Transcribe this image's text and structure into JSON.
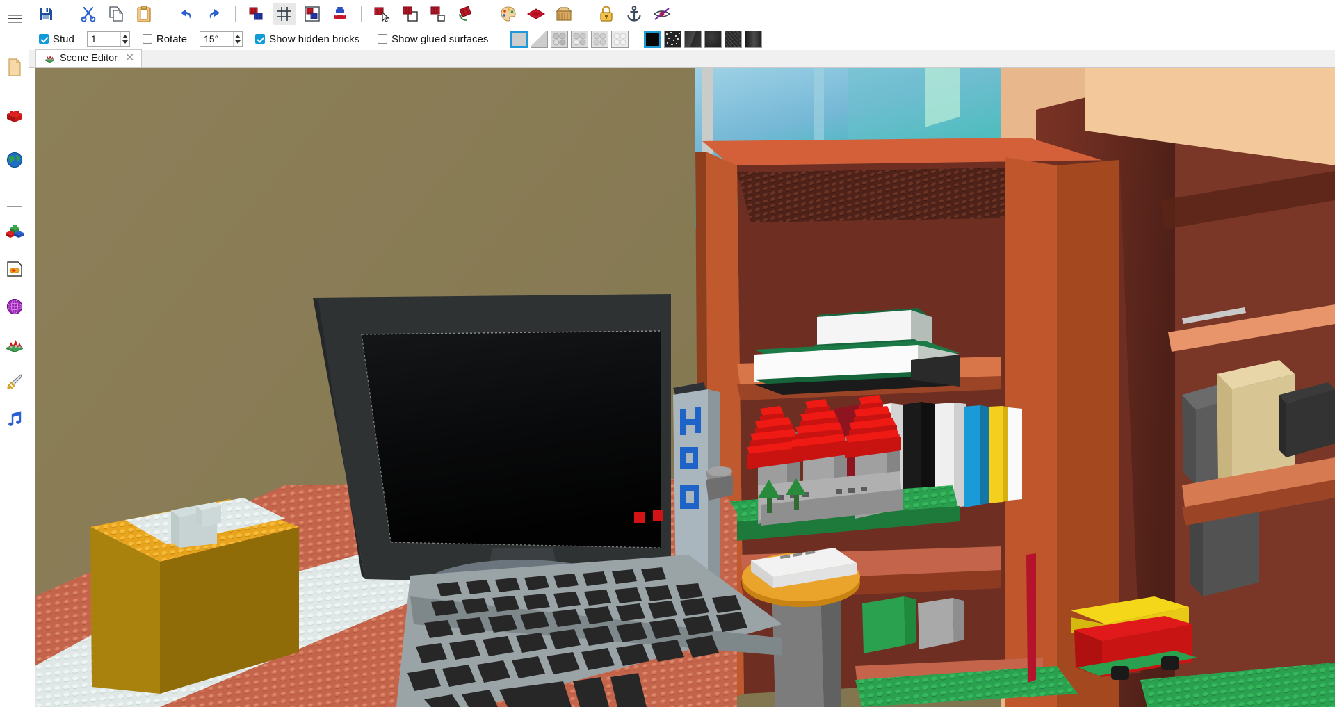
{
  "app": {
    "title": "Scene Editor"
  },
  "sidebar": {
    "items": [
      {
        "name": "menu",
        "icon": "hamburger-menu-icon",
        "label": "Menu"
      },
      {
        "name": "document",
        "icon": "document-page-icon",
        "label": "Document"
      },
      {
        "name": "brick",
        "icon": "red-brick-icon",
        "label": "Brick"
      },
      {
        "name": "world",
        "icon": "globe-icon",
        "label": "World"
      },
      {
        "name": "parts",
        "icon": "brick-group-icon",
        "label": "Parts"
      },
      {
        "name": "textures",
        "icon": "texture-page-icon",
        "label": "Textures"
      },
      {
        "name": "sphere",
        "icon": "purple-sphere-icon",
        "label": "Sphere"
      },
      {
        "name": "castle",
        "icon": "castle-icon",
        "label": "Castle"
      },
      {
        "name": "sword",
        "icon": "sword-icon",
        "label": "Sword"
      },
      {
        "name": "music",
        "icon": "music-note-icon",
        "label": "Music"
      }
    ]
  },
  "toolbar": {
    "groups": [
      {
        "buttons": [
          {
            "name": "save",
            "icon": "floppy-save-icon",
            "label": "Save",
            "active": false
          }
        ]
      },
      {
        "buttons": [
          {
            "name": "cut",
            "icon": "scissors-icon",
            "label": "Cut",
            "active": false
          },
          {
            "name": "copy",
            "icon": "copy-icon",
            "label": "Copy",
            "active": false
          },
          {
            "name": "paste",
            "icon": "clipboard-icon",
            "label": "Paste",
            "active": false
          }
        ]
      },
      {
        "buttons": [
          {
            "name": "undo",
            "icon": "undo-arrow-icon",
            "label": "Undo",
            "active": false
          },
          {
            "name": "redo",
            "icon": "redo-arrow-icon",
            "label": "Redo",
            "active": false
          }
        ]
      },
      {
        "buttons": [
          {
            "name": "insert-brick",
            "icon": "bricks-stack-icon",
            "label": "Insert Brick",
            "active": false
          },
          {
            "name": "toggle-grid",
            "icon": "grid-icon",
            "label": "Grid",
            "active": true
          },
          {
            "name": "group-bricks",
            "icon": "brick-frame-icon",
            "label": "Group",
            "active": false
          },
          {
            "name": "minifig",
            "icon": "minifig-icon",
            "label": "Minifigure",
            "active": false
          }
        ]
      },
      {
        "buttons": [
          {
            "name": "select-tool",
            "icon": "brick-cursor-icon",
            "label": "Select",
            "active": false
          },
          {
            "name": "move-tool",
            "icon": "brick-move-icon",
            "label": "Move",
            "active": false
          },
          {
            "name": "clone-tool",
            "icon": "brick-clone-icon",
            "label": "Clone",
            "active": false
          },
          {
            "name": "rotate-tool",
            "icon": "brick-rotate-icon",
            "label": "Rotate",
            "active": false
          }
        ]
      },
      {
        "buttons": [
          {
            "name": "palette",
            "icon": "paint-palette-icon",
            "label": "Color Palette",
            "active": false
          },
          {
            "name": "material",
            "icon": "red-gem-icon",
            "label": "Material",
            "active": false
          },
          {
            "name": "box",
            "icon": "cardboard-box-icon",
            "label": "Parts Bin",
            "active": false
          }
        ]
      },
      {
        "buttons": [
          {
            "name": "lock",
            "icon": "padlock-icon",
            "label": "Lock",
            "active": false
          },
          {
            "name": "anchor",
            "icon": "anchor-icon",
            "label": "Anchor",
            "active": false
          },
          {
            "name": "hide",
            "icon": "eye-crossed-icon",
            "label": "Hide",
            "active": false
          }
        ]
      }
    ]
  },
  "options": {
    "stud": {
      "label": "Stud",
      "checked": true,
      "value": "1"
    },
    "rotate": {
      "label": "Rotate",
      "checked": false,
      "value": "15°"
    },
    "show_hidden_bricks": {
      "label": "Show hidden bricks",
      "checked": true
    },
    "show_glued_surfaces": {
      "label": "Show glued surfaces",
      "checked": false
    },
    "surface_swatches": [
      {
        "name": "plain-light",
        "fill": "#cdcdcd",
        "selected": true,
        "studs": 0,
        "bevel": false
      },
      {
        "name": "plain-bevel",
        "fill": "#d2d2d2",
        "selected": false,
        "studs": 0,
        "bevel": true
      },
      {
        "name": "studs-2x2-dark",
        "fill": "#d6d6d6",
        "selected": false,
        "studs": 4,
        "studfill": "#b4b4b4"
      },
      {
        "name": "studs-2x2-mixed",
        "fill": "#dcdcdc",
        "selected": false,
        "studs": 4,
        "studfill": "#c4c4c4"
      },
      {
        "name": "studs-2x2-light",
        "fill": "#e0e0e0",
        "selected": false,
        "studs": 4,
        "studfill": "#c9c9c9"
      },
      {
        "name": "studs-2x2-faint",
        "fill": "#ebebeb",
        "selected": false,
        "studs": 4,
        "studfill": "#dddddd"
      }
    ],
    "texture_swatches": [
      {
        "name": "texture-black",
        "fill": "#060606",
        "selected": true
      },
      {
        "name": "texture-speckle",
        "fill": "#2a2a2a",
        "selected": false
      },
      {
        "name": "texture-streak",
        "fill": "#3a3a3a",
        "selected": false
      },
      {
        "name": "texture-matte",
        "fill": "#303030",
        "selected": false
      },
      {
        "name": "texture-scratch",
        "fill": "#343434",
        "selected": false
      },
      {
        "name": "texture-gradient",
        "fill": "#2e2e2e",
        "selected": false
      }
    ]
  },
  "tabs": [
    {
      "name": "scene-editor",
      "label": "Scene Editor",
      "icon": "castle-tab-icon",
      "active": true,
      "closable": true,
      "close_glyph": "✕"
    }
  ],
  "viewport": {
    "name": "3d-scene-viewport",
    "description": "3D LEGO brick scene: desk with monitor, keyboard, bookshelf, castle model",
    "colors": {
      "wall": "#8a7d55",
      "desk_plate": "#c4654b",
      "shelf_wood": "#c05a2e",
      "shelf_interior": "#6e2f22",
      "monitor_bezel": "#2f3233",
      "monitor_screen": "#080808",
      "keyboard_base": "#9aa3a6",
      "key": "#2a2a2a",
      "castle_tower": "#e8150f",
      "castle_wall": "#9d9d9d",
      "baseplate_green": "#2aa14e",
      "window_sky": "#6fb3d2",
      "book_white": "#f2f2f2",
      "book_green": "#1f6b41",
      "book_blue": "#1a9bd7",
      "book_yellow": "#f5cf1f",
      "book_red": "#8e1420",
      "mouse_pad": "#eaa32b",
      "bottle_label": "#1e63c8",
      "desk_leg": "#7a7a7a",
      "pedestal_gold": "#a8820c"
    },
    "objects": [
      {
        "name": "wall-backdrop",
        "label": "Olive wall"
      },
      {
        "name": "window",
        "label": "Window with sky view"
      },
      {
        "name": "desk-surface",
        "label": "Red brick desk plate"
      },
      {
        "name": "monitor",
        "label": "LCD monitor"
      },
      {
        "name": "monitor-stand",
        "label": "Monitor stand"
      },
      {
        "name": "keyboard",
        "label": "Keyboard"
      },
      {
        "name": "mouse",
        "label": "Mouse on orange pad"
      },
      {
        "name": "water-bottle",
        "label": "H2O water bottle"
      },
      {
        "name": "bookshelf",
        "label": "Wooden bookshelf"
      },
      {
        "name": "castle-model",
        "label": "Red and gray castle on green baseplate"
      },
      {
        "name": "books-row",
        "label": "Row of colored books"
      },
      {
        "name": "stacked-boxes",
        "label": "Stacked green and white boxes"
      },
      {
        "name": "white-pedestal",
        "label": "White brick on gold pedestal"
      },
      {
        "name": "red-vehicle",
        "label": "Red vehicle on lower shelf"
      },
      {
        "name": "desk-leg",
        "label": "Gray desk leg"
      },
      {
        "name": "green-baseplate-floor",
        "label": "Green baseplate floor section"
      }
    ]
  }
}
